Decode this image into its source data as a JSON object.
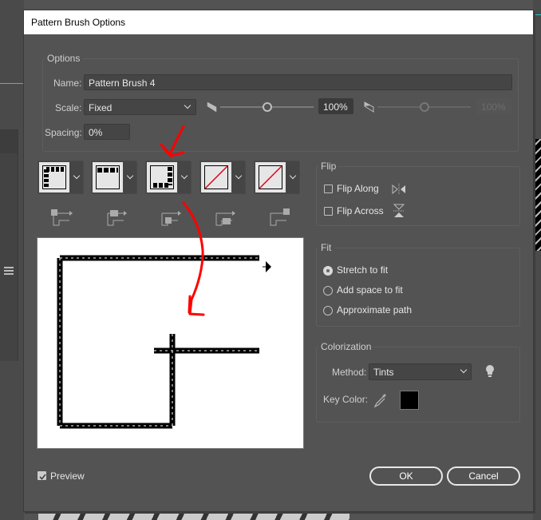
{
  "dialog": {
    "title": "Pattern Brush Options",
    "options": {
      "legend": "Options",
      "name_label": "Name:",
      "name_value": "Pattern Brush 4",
      "scale_label": "Scale:",
      "scale_value": "Fixed",
      "scale_min": "100%",
      "scale_max": "100%",
      "spacing_label": "Spacing:",
      "spacing_value": "0%"
    },
    "tiles": [
      {
        "name": "outer-corner-tile",
        "type": "corner"
      },
      {
        "name": "side-tile",
        "type": "side"
      },
      {
        "name": "inner-corner-tile",
        "type": "inner-corner"
      },
      {
        "name": "start-tile",
        "type": "none"
      },
      {
        "name": "end-tile",
        "type": "none"
      }
    ],
    "flip": {
      "legend": "Flip",
      "flip_along": "Flip Along",
      "flip_along_checked": false,
      "flip_across": "Flip Across",
      "flip_across_checked": false
    },
    "fit": {
      "legend": "Fit",
      "options": [
        "Stretch to fit",
        "Add space to fit",
        "Approximate path"
      ],
      "selected": "Stretch to fit"
    },
    "colorization": {
      "legend": "Colorization",
      "method_label": "Method:",
      "method_value": "Tints",
      "key_color_label": "Key Color:",
      "key_color": "#000000"
    },
    "preview_label": "Preview",
    "preview_checked": true,
    "ok_label": "OK",
    "cancel_label": "Cancel",
    "annotation_color": "#ff0000"
  }
}
